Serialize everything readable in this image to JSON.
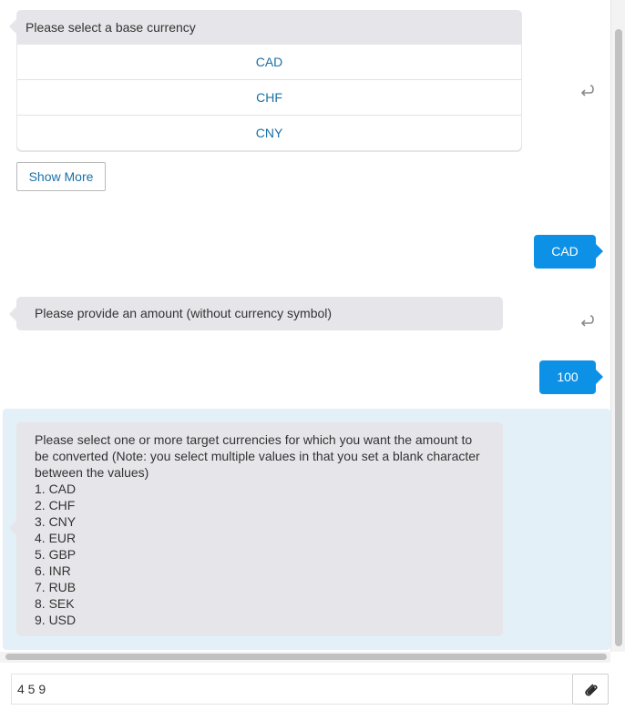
{
  "messages": {
    "base_currency": {
      "prompt": "Please select a base currency",
      "options": [
        "CAD",
        "CHF",
        "CNY"
      ],
      "show_more_label": "Show More"
    },
    "user_reply_1": "CAD",
    "amount_prompt": "Please provide an amount (without currency symbol)",
    "user_reply_2": "100",
    "target_currencies": {
      "intro": "Please select one or more target currencies for which you want the amount to be converted (Note: you select multiple values in that you set a blank character between the values)",
      "list": [
        "1. CAD",
        "2. CHF",
        "3. CNY",
        "4. EUR",
        "5. GBP",
        "6. INR",
        "7. RUB",
        "8. SEK",
        "9. USD"
      ]
    }
  },
  "composer": {
    "input_value": "4 5 9",
    "attach_icon": "paperclip-icon"
  },
  "icons": {
    "reply": "reply-icon"
  },
  "colors": {
    "user_bubble": "#0d91e6",
    "bot_bubble": "#e6e6ea",
    "link": "#1a6fa6",
    "highlight": "#e3f0f8"
  }
}
